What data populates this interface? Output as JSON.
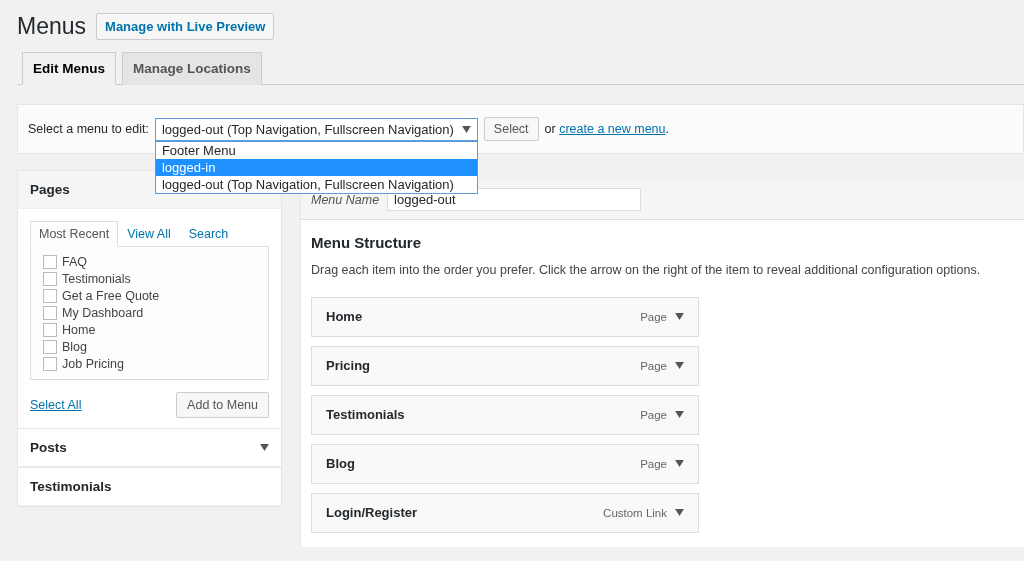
{
  "page": {
    "title": "Menus",
    "live_preview_button": "Manage with Live Preview"
  },
  "tabs": [
    {
      "label": "Edit Menus",
      "selected": true
    },
    {
      "label": "Manage Locations",
      "selected": false
    }
  ],
  "menu_select": {
    "label": "Select a menu to edit:",
    "value": "logged-out (Top Navigation, Fullscreen Navigation)",
    "expanded": true,
    "options": [
      {
        "label": "Footer Menu",
        "highlighted": false
      },
      {
        "label": "logged-in",
        "highlighted": true
      },
      {
        "label": "logged-out (Top Navigation, Fullscreen Navigation)",
        "highlighted": false
      }
    ],
    "button": "Select",
    "or_text": "or",
    "create_link": "create a new menu",
    "after_link": "."
  },
  "pages_box": {
    "title": "Pages",
    "tabs": [
      {
        "label": "Most Recent",
        "selected": true
      },
      {
        "label": "View All",
        "selected": false
      },
      {
        "label": "Search",
        "selected": false
      }
    ],
    "items": [
      {
        "label": "FAQ",
        "checked": false
      },
      {
        "label": "Testimonials",
        "checked": false
      },
      {
        "label": "Get a Free Quote",
        "checked": false
      },
      {
        "label": "My Dashboard",
        "checked": false
      },
      {
        "label": "Home",
        "checked": false
      },
      {
        "label": "Blog",
        "checked": false
      },
      {
        "label": "Job Pricing",
        "checked": false
      }
    ],
    "select_all": "Select All",
    "add_button": "Add to Menu"
  },
  "other_sections": [
    {
      "title": "Posts",
      "arrow": true
    },
    {
      "title": "Testimonials",
      "arrow": false
    }
  ],
  "menu_name": {
    "label": "Menu Name",
    "value": "logged-out"
  },
  "structure": {
    "title": "Menu Structure",
    "description": "Drag each item into the order you prefer. Click the arrow on the right of the item to reveal additional configuration options.",
    "items": [
      {
        "title": "Home",
        "type": "Page"
      },
      {
        "title": "Pricing",
        "type": "Page"
      },
      {
        "title": "Testimonials",
        "type": "Page"
      },
      {
        "title": "Blog",
        "type": "Page"
      },
      {
        "title": "Login/Register",
        "type": "Custom Link"
      }
    ]
  }
}
